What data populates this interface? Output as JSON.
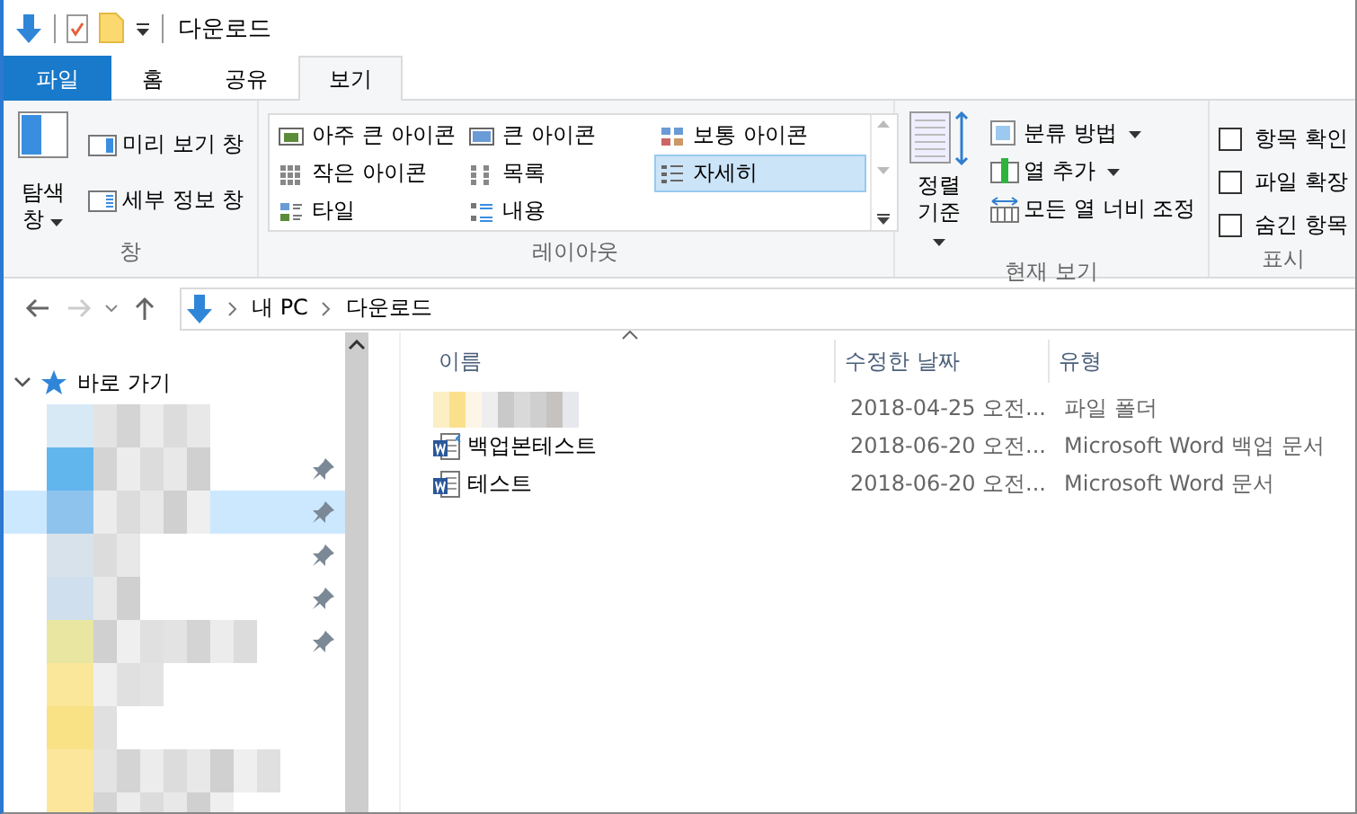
{
  "window": {
    "title": "다운로드"
  },
  "tabs": [
    {
      "label": "파일",
      "kind": "file",
      "selected": false
    },
    {
      "label": "홈",
      "kind": "tab",
      "selected": false
    },
    {
      "label": "공유",
      "kind": "tab",
      "selected": false
    },
    {
      "label": "보기",
      "kind": "tab",
      "selected": true
    }
  ],
  "ribbon": {
    "panes": {
      "label": "창",
      "nav_pane": {
        "line1": "탐색",
        "line2": "창"
      },
      "buttons": [
        {
          "label": "미리 보기 창",
          "kind": "preview"
        },
        {
          "label": "세부 정보 창",
          "kind": "details"
        }
      ]
    },
    "layout": {
      "label": "레이아웃",
      "items": [
        {
          "label": "아주 큰 아이콘",
          "kind": "xl",
          "selected": false
        },
        {
          "label": "큰 아이콘",
          "kind": "large",
          "selected": false
        },
        {
          "label": "보통 아이콘",
          "kind": "medium",
          "selected": false
        },
        {
          "label": "작은 아이콘",
          "kind": "small",
          "selected": false
        },
        {
          "label": "목록",
          "kind": "list",
          "selected": false
        },
        {
          "label": "자세히",
          "kind": "details",
          "selected": true
        },
        {
          "label": "타일",
          "kind": "tiles",
          "selected": false
        },
        {
          "label": "내용",
          "kind": "content",
          "selected": false
        }
      ]
    },
    "current_view": {
      "label": "현재 보기",
      "sort": {
        "line1": "정렬",
        "line2": "기준"
      },
      "buttons": [
        {
          "label": "분류 방법",
          "kind": "group",
          "dropdown": true
        },
        {
          "label": "열 추가",
          "kind": "add",
          "dropdown": true
        },
        {
          "label": "모든 열 너비 조정",
          "kind": "fit",
          "dropdown": false
        }
      ]
    },
    "show_hide": {
      "label": "표시",
      "checkboxes": [
        {
          "label": "항목 확인",
          "checked": false
        },
        {
          "label": "파일 확장",
          "checked": false
        },
        {
          "label": "숨긴 항목",
          "checked": false
        }
      ]
    }
  },
  "address": {
    "path": [
      "내 PC",
      "다운로드"
    ]
  },
  "nav": {
    "header": "바로 가기",
    "expanded": true,
    "items": [
      {
        "pinned": false,
        "selected": false,
        "color": "#d8e9f6"
      },
      {
        "pinned": true,
        "selected": false,
        "color": "#62b6ee"
      },
      {
        "pinned": true,
        "selected": true,
        "color": "#8ec3ee"
      },
      {
        "pinned": true,
        "selected": false,
        "color": "#d8e2ea"
      },
      {
        "pinned": true,
        "selected": false,
        "color": "#cfdfee"
      },
      {
        "pinned": true,
        "selected": false,
        "color": "#e8e6a0"
      },
      {
        "pinned": false,
        "selected": false,
        "color": "#fbe79a"
      },
      {
        "pinned": false,
        "selected": false,
        "color": "#f9e286"
      },
      {
        "pinned": false,
        "selected": false,
        "color": "#fbe69c"
      },
      {
        "pinned": false,
        "selected": false,
        "color": "#fbe69c"
      }
    ]
  },
  "files": {
    "columns": [
      {
        "label": "이름",
        "sorted": true
      },
      {
        "label": "수정한 날짜",
        "sorted": false
      },
      {
        "label": "유형",
        "sorted": false
      }
    ],
    "rows": [
      {
        "kind": "folder",
        "modified": "2018-04-25 오전...",
        "type": "파일 폴더"
      },
      {
        "kind": "word-backup",
        "name": "백업본테스트",
        "modified": "2018-06-20 오전...",
        "type": "Microsoft Word 백업 문서"
      },
      {
        "kind": "word",
        "name": "테스트",
        "modified": "2018-06-20 오전...",
        "type": "Microsoft Word 문서"
      }
    ]
  }
}
